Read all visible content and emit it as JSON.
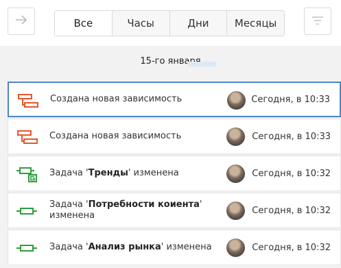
{
  "toolbar": {
    "back_icon": "arrow-right-icon",
    "filter_icon": "filter-icon",
    "segments": [
      "Все",
      "Часы",
      "Дни",
      "Месяцы"
    ]
  },
  "date_label": "15-го января",
  "events": [
    {
      "icon": "dependency-icon",
      "text": "Создана новая зависимость",
      "time": "Сегодня, в 10:33"
    },
    {
      "icon": "dependency-icon",
      "text": "Создана новая зависимость",
      "time": "Сегодня, в 10:33"
    },
    {
      "icon": "task-badge-icon",
      "prefix": "Задача '",
      "bold": "Тренды",
      "suffix": "' изменена",
      "time": "Сегодня, в 10:32"
    },
    {
      "icon": "task-icon",
      "prefix": "Задача '",
      "bold": "Потребности коиента",
      "suffix": "' изменена",
      "time": "Сегодня, в 10:32"
    },
    {
      "icon": "task-icon",
      "prefix": "Задача '",
      "bold": "Анализ рынка",
      "suffix": "' изменена",
      "time": "Сегодня, в 10:32"
    }
  ],
  "colors": {
    "accent": "#4a86c8",
    "dependency": "#e8562a",
    "task": "#2e9e3e"
  }
}
